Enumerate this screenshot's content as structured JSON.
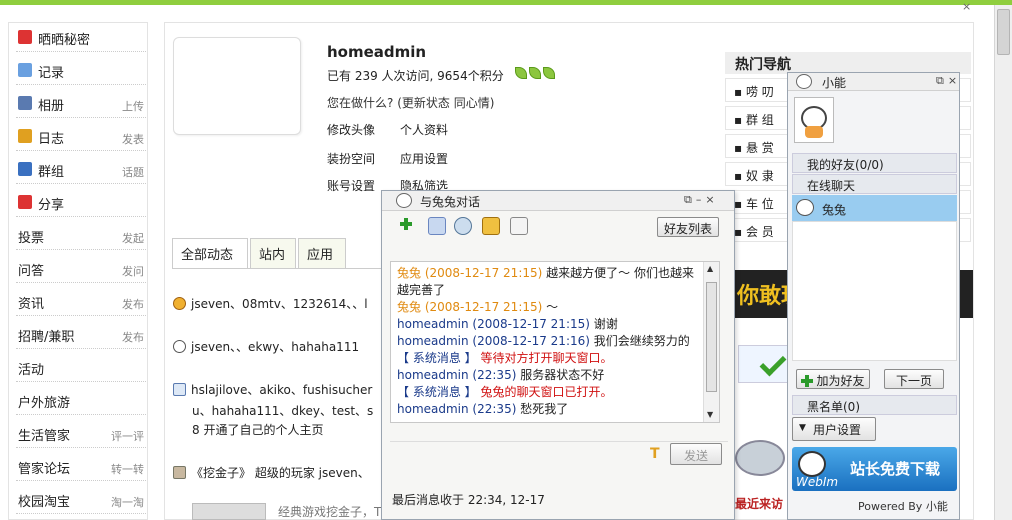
{
  "sidebar": {
    "items": [
      {
        "label": "晒晒秘密",
        "action": ""
      },
      {
        "label": "记录",
        "action": ""
      },
      {
        "label": "相册",
        "action": "上传"
      },
      {
        "label": "日志",
        "action": "发表"
      },
      {
        "label": "群组",
        "action": "话题"
      },
      {
        "label": "分享",
        "action": ""
      },
      {
        "label": "投票",
        "action": "发起"
      },
      {
        "label": "问答",
        "action": "发问"
      },
      {
        "label": "资讯",
        "action": "发布"
      },
      {
        "label": "招聘/兼职",
        "action": "发布"
      },
      {
        "label": "活动",
        "action": ""
      },
      {
        "label": "户外旅游",
        "action": ""
      },
      {
        "label": "生活管家",
        "action": "评一评"
      },
      {
        "label": "管家论坛",
        "action": "转一转"
      },
      {
        "label": "校园淘宝",
        "action": "淘一淘"
      }
    ]
  },
  "profile": {
    "username": "homeadmin",
    "stats": "已有  239  人次访问, 9654个积分",
    "doing_prompt": "您在做什么?",
    "update_status": "(更新状态",
    "mood": "同心情)",
    "links": [
      "修改头像",
      "个人资料",
      "装扮空间",
      "应用设置",
      "账号设置",
      "隐私筛选"
    ]
  },
  "tabs": [
    "全部动态",
    "站内",
    "应用"
  ],
  "feed": [
    "jseven、08mtv、1232614、、l",
    "jseven、、ekwy、hahaha111",
    "hslajilove、akiko、fushisucher",
    "u、hahaha111、dkey、test、s",
    "8 开通了自己的个人主页",
    "《挖金子》 超级的玩家 jseven、",
    "经典游戏挖金子，T"
  ],
  "hot_nav": {
    "title": "热门导航",
    "items": [
      "▪ 唠  叨",
      "▪ 群  组",
      "▪ 悬  赏",
      "▪ 奴  隶",
      "▪ 车  位",
      "▪ 会  员"
    ]
  },
  "banner_text": "你敢玩",
  "recent_label": "最近来访",
  "chat": {
    "title": "与兔兔对话",
    "friend_list_button": "好友列表",
    "send_button": "发送",
    "last_message": "最后消息收于 22:34, 12-17",
    "messages": [
      {
        "who": "兔兔 (2008-12-17 21:15)",
        "text": " 越来越方便了～ 你们也越来越完善了"
      },
      {
        "who": "兔兔 (2008-12-17 21:15)",
        "text": " ～"
      },
      {
        "who": "homeadmin (2008-12-17 21:15)",
        "text": " 谢谢"
      },
      {
        "who": "homeadmin (2008-12-17 21:16)",
        "text": " 我们会继续努力的"
      },
      {
        "who": "【 系统消息 】",
        "text": " 等待对方打开聊天窗口。"
      },
      {
        "who": "homeadmin (22:35)",
        "text": " 服务器状态不好"
      },
      {
        "who": "【 系统消息 】",
        "text": " 兔兔的聊天窗口已打开。"
      },
      {
        "who": "homeadmin (22:35)",
        "text": " 愁死我了"
      }
    ]
  },
  "buddy": {
    "title": "小能",
    "my_friends": "我的好友(0/0)",
    "online_chat": "在线聊天",
    "friend_name": "兔兔",
    "add_friend": "加为好友",
    "next_page": "下一页",
    "blacklist": "黑名单(0)",
    "user_settings": "用户设置",
    "webim_brand": "WebIm",
    "download": "站长免费下载",
    "powered_by": "Powered By 小能"
  }
}
